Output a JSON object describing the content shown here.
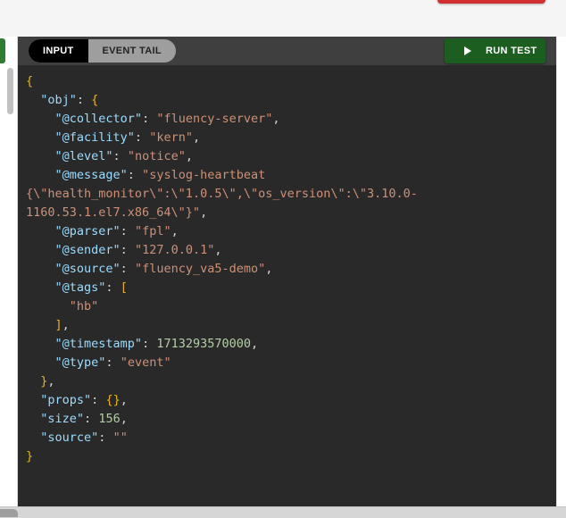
{
  "tabs": [
    {
      "label": "INPUT",
      "active": true
    },
    {
      "label": "EVENT TAIL",
      "active": false
    }
  ],
  "run_test": {
    "label": "RUN TEST",
    "icon": "play-icon"
  },
  "colors": {
    "panel_bg": "#292929",
    "toolbar_bg": "#3f3f3f",
    "run_button": "#1b5e20",
    "brace": "#e9b320",
    "key": "#9cdcfe",
    "string": "#ce9178",
    "number": "#b5cea8"
  },
  "code_lines": [
    [
      {
        "t": "b",
        "v": "{"
      }
    ],
    [
      {
        "t": "p",
        "v": "  "
      },
      {
        "t": "k",
        "v": "\"obj\""
      },
      {
        "t": "p",
        "v": ": "
      },
      {
        "t": "b",
        "v": "{"
      }
    ],
    [
      {
        "t": "p",
        "v": "    "
      },
      {
        "t": "k",
        "v": "\"@collector\""
      },
      {
        "t": "p",
        "v": ": "
      },
      {
        "t": "s",
        "v": "\"fluency-server\""
      },
      {
        "t": "p",
        "v": ","
      }
    ],
    [
      {
        "t": "p",
        "v": "    "
      },
      {
        "t": "k",
        "v": "\"@facility\""
      },
      {
        "t": "p",
        "v": ": "
      },
      {
        "t": "s",
        "v": "\"kern\""
      },
      {
        "t": "p",
        "v": ","
      }
    ],
    [
      {
        "t": "p",
        "v": "    "
      },
      {
        "t": "k",
        "v": "\"@level\""
      },
      {
        "t": "p",
        "v": ": "
      },
      {
        "t": "s",
        "v": "\"notice\""
      },
      {
        "t": "p",
        "v": ","
      }
    ],
    [
      {
        "t": "p",
        "v": "    "
      },
      {
        "t": "k",
        "v": "\"@message\""
      },
      {
        "t": "p",
        "v": ": "
      },
      {
        "t": "s",
        "v": "\"syslog-heartbeat"
      }
    ],
    [
      {
        "t": "s",
        "v": "{\\\"health_monitor\\\":\\\"1.0.5\\\",\\\"os_version\\\":\\\"3.10.0-"
      }
    ],
    [
      {
        "t": "s",
        "v": "1160.53.1.el7.x86_64\\\"}\""
      },
      {
        "t": "p",
        "v": ","
      }
    ],
    [
      {
        "t": "p",
        "v": "    "
      },
      {
        "t": "k",
        "v": "\"@parser\""
      },
      {
        "t": "p",
        "v": ": "
      },
      {
        "t": "s",
        "v": "\"fpl\""
      },
      {
        "t": "p",
        "v": ","
      }
    ],
    [
      {
        "t": "p",
        "v": "    "
      },
      {
        "t": "k",
        "v": "\"@sender\""
      },
      {
        "t": "p",
        "v": ": "
      },
      {
        "t": "s",
        "v": "\"127.0.0.1\""
      },
      {
        "t": "p",
        "v": ","
      }
    ],
    [
      {
        "t": "p",
        "v": "    "
      },
      {
        "t": "k",
        "v": "\"@source\""
      },
      {
        "t": "p",
        "v": ": "
      },
      {
        "t": "s",
        "v": "\"fluency_va5-demo\""
      },
      {
        "t": "p",
        "v": ","
      }
    ],
    [
      {
        "t": "p",
        "v": "    "
      },
      {
        "t": "k",
        "v": "\"@tags\""
      },
      {
        "t": "p",
        "v": ": "
      },
      {
        "t": "b",
        "v": "["
      }
    ],
    [
      {
        "t": "p",
        "v": "      "
      },
      {
        "t": "s",
        "v": "\"hb\""
      }
    ],
    [
      {
        "t": "p",
        "v": "    "
      },
      {
        "t": "b",
        "v": "]"
      },
      {
        "t": "p",
        "v": ","
      }
    ],
    [
      {
        "t": "p",
        "v": "    "
      },
      {
        "t": "k",
        "v": "\"@timestamp\""
      },
      {
        "t": "p",
        "v": ": "
      },
      {
        "t": "n",
        "v": "1713293570000"
      },
      {
        "t": "p",
        "v": ","
      }
    ],
    [
      {
        "t": "p",
        "v": "    "
      },
      {
        "t": "k",
        "v": "\"@type\""
      },
      {
        "t": "p",
        "v": ": "
      },
      {
        "t": "s",
        "v": "\"event\""
      }
    ],
    [
      {
        "t": "p",
        "v": "  "
      },
      {
        "t": "b",
        "v": "}"
      },
      {
        "t": "p",
        "v": ","
      }
    ],
    [
      {
        "t": "p",
        "v": "  "
      },
      {
        "t": "k",
        "v": "\"props\""
      },
      {
        "t": "p",
        "v": ": "
      },
      {
        "t": "b",
        "v": "{}"
      },
      {
        "t": "p",
        "v": ","
      }
    ],
    [
      {
        "t": "p",
        "v": "  "
      },
      {
        "t": "k",
        "v": "\"size\""
      },
      {
        "t": "p",
        "v": ": "
      },
      {
        "t": "n",
        "v": "156"
      },
      {
        "t": "p",
        "v": ","
      }
    ],
    [
      {
        "t": "p",
        "v": "  "
      },
      {
        "t": "k",
        "v": "\"source\""
      },
      {
        "t": "p",
        "v": ": "
      },
      {
        "t": "s",
        "v": "\"\""
      }
    ],
    [
      {
        "t": "b",
        "v": "}"
      }
    ]
  ]
}
